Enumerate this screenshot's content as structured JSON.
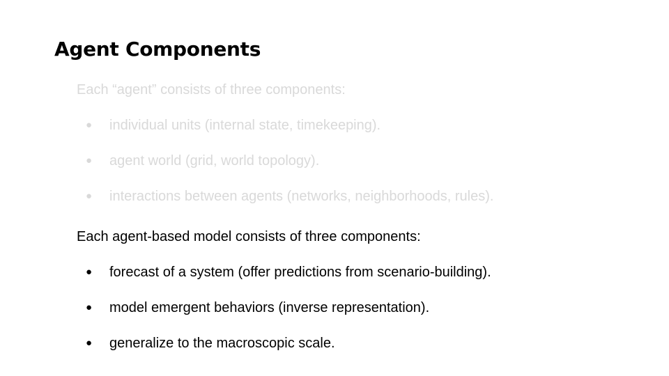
{
  "slide": {
    "title": "Agent Components",
    "faded_section": {
      "intro": "Each “agent” consists of three components:",
      "items": [
        "individual units (internal state, timekeeping).",
        "agent world (grid, world topology).",
        "interactions between agents (networks, neighborhoods, rules)."
      ],
      "color": "#d9d9d9"
    },
    "active_section": {
      "intro": "Each agent-based model consists of three components:",
      "items": [
        "forecast of a system (offer predictions from scenario-building).",
        "model emergent behaviors (inverse representation).",
        "generalize to the macroscopic scale."
      ],
      "color": "#000000"
    },
    "bullet_glyph": "●"
  }
}
